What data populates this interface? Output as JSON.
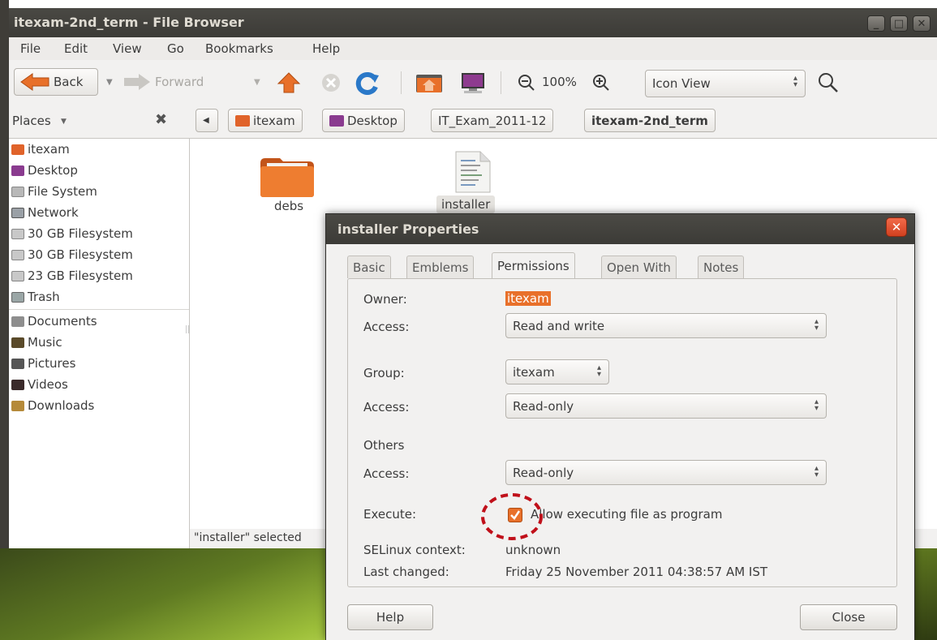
{
  "window": {
    "title": "itexam-2nd_term - File Browser",
    "controls": {
      "minimize": "_",
      "maximize": "□",
      "close": "✕"
    }
  },
  "menubar": [
    "File",
    "Edit",
    "View",
    "Go",
    "Bookmarks",
    "Help"
  ],
  "toolbar": {
    "back_label": "Back",
    "forward_label": "Forward",
    "zoom_level": "100%",
    "view_mode": "Icon View"
  },
  "sidebar": {
    "header": "Places",
    "devices": [
      {
        "label": "itexam",
        "icon": "home-folder-icon",
        "color": "#e0632a"
      },
      {
        "label": "Desktop",
        "icon": "desktop-icon",
        "color": "#8a3b8f"
      },
      {
        "label": "File System",
        "icon": "drive-icon",
        "color": "#9a9a9a"
      },
      {
        "label": "Network",
        "icon": "network-icon",
        "color": "#9a9a9a"
      },
      {
        "label": "30 GB Filesystem",
        "icon": "drive-icon",
        "color": "#9a9a9a"
      },
      {
        "label": "30 GB Filesystem",
        "icon": "drive-icon",
        "color": "#9a9a9a"
      },
      {
        "label": "23 GB Filesystem",
        "icon": "drive-icon",
        "color": "#9a9a9a"
      },
      {
        "label": "Trash",
        "icon": "trash-icon",
        "color": "#7a8a8a"
      }
    ],
    "bookmarks": [
      {
        "label": "Documents",
        "icon": "documents-folder-icon",
        "color": "#7a7a7a"
      },
      {
        "label": "Music",
        "icon": "music-folder-icon",
        "color": "#5a4a2a"
      },
      {
        "label": "Pictures",
        "icon": "pictures-folder-icon",
        "color": "#555"
      },
      {
        "label": "Videos",
        "icon": "videos-folder-icon",
        "color": "#3a2a2a"
      },
      {
        "label": "Downloads",
        "icon": "downloads-folder-icon",
        "color": "#b58a3a"
      }
    ]
  },
  "breadcrumbs": [
    "itexam",
    "Desktop",
    "IT_Exam_2011-12",
    "itexam-2nd_term"
  ],
  "files": [
    {
      "name": "debs",
      "type": "folder"
    },
    {
      "name": "installer",
      "type": "text-file"
    }
  ],
  "status": "\"installer\" selected",
  "dialog": {
    "title": "installer Properties",
    "tabs": [
      "Basic",
      "Emblems",
      "Permissions",
      "Open With",
      "Notes"
    ],
    "active_tab": "Permissions",
    "owner_label": "Owner:",
    "owner_value": "itexam",
    "owner_access_label": "Access:",
    "owner_access": "Read and write",
    "group_label": "Group:",
    "group_value": "itexam",
    "group_access_label": "Access:",
    "group_access": "Read-only",
    "others_label": "Others",
    "others_access_label": "Access:",
    "others_access": "Read-only",
    "execute_label": "Execute:",
    "execute_checkbox_label": "Allow executing file as program",
    "execute_checked": true,
    "selinux_label": "SELinux context:",
    "selinux_value": "unknown",
    "last_changed_label": "Last changed:",
    "last_changed_value": "Friday 25 November 2011 04:38:57 AM IST",
    "help_button": "Help",
    "close_button": "Close"
  },
  "colors": {
    "accent_orange": "#e8702a",
    "title_bar": "#3c3b37",
    "highlight_circle": "#c0101a"
  }
}
